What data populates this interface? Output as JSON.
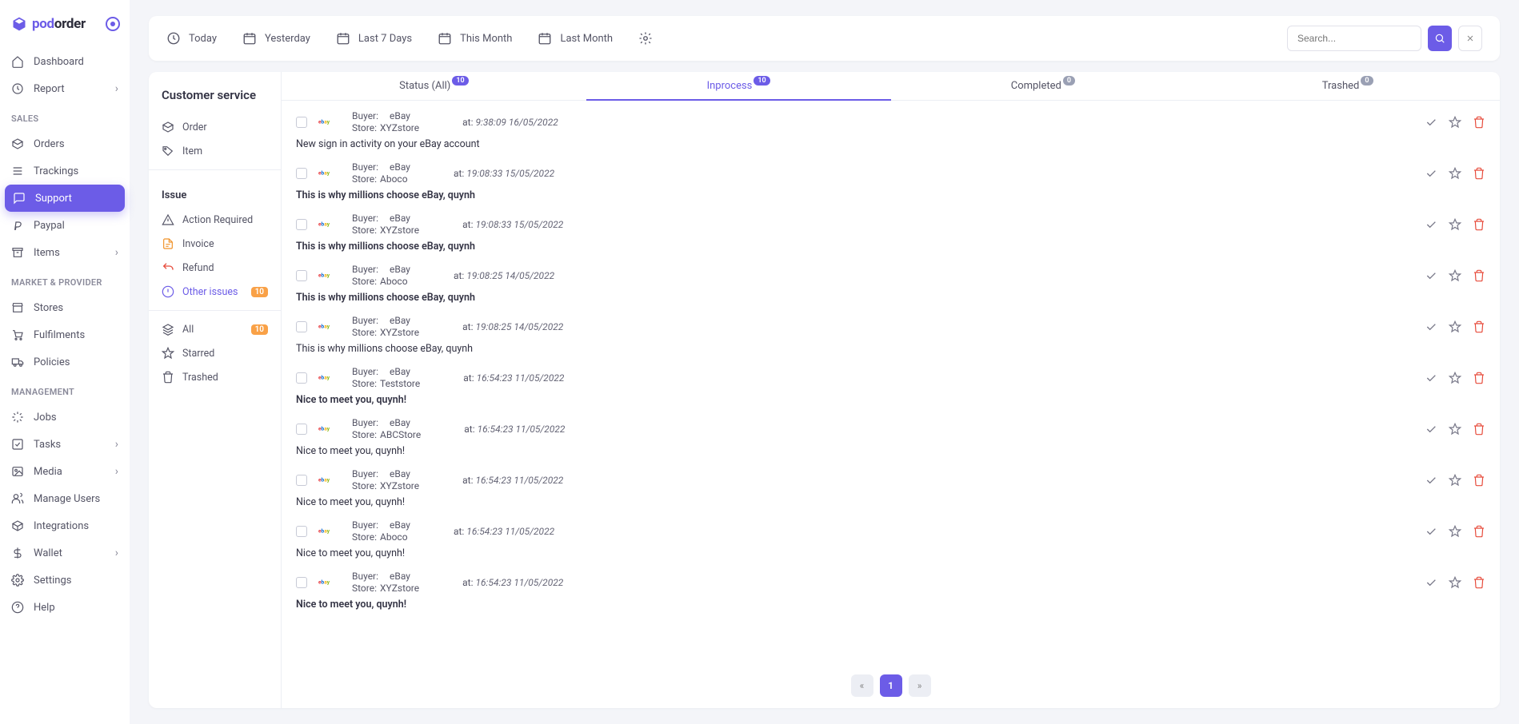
{
  "brand": {
    "name_pod": "pod",
    "name_order": "order"
  },
  "nav": {
    "dashboard": "Dashboard",
    "report": "Report",
    "sales": "SALES",
    "orders": "Orders",
    "trackings": "Trackings",
    "support": "Support",
    "paypal": "Paypal",
    "items": "Items",
    "market": "MARKET & PROVIDER",
    "stores": "Stores",
    "fulfilments": "Fulfilments",
    "policies": "Policies",
    "management": "MANAGEMENT",
    "jobs": "Jobs",
    "tasks": "Tasks",
    "media": "Media",
    "manage_users": "Manage Users",
    "integrations": "Integrations",
    "wallet": "Wallet",
    "settings": "Settings",
    "help": "Help"
  },
  "toolbar": {
    "today": "Today",
    "yesterday": "Yesterday",
    "last7": "Last 7 Days",
    "this_month": "This Month",
    "last_month": "Last Month",
    "search_placeholder": "Search..."
  },
  "cs": {
    "title": "Customer service",
    "order": "Order",
    "item": "Item",
    "issue": "Issue",
    "action_required": "Action Required",
    "invoice": "Invoice",
    "refund": "Refund",
    "other_issues": "Other issues",
    "other_issues_badge": "10",
    "all": "All",
    "all_badge": "10",
    "starred": "Starred",
    "trashed": "Trashed"
  },
  "tabs": {
    "status_all": "Status (All)",
    "status_all_count": "10",
    "inprocess": "Inprocess",
    "inprocess_count": "10",
    "completed": "Completed",
    "completed_count": "0",
    "trashed": "Trashed",
    "trashed_count": "0"
  },
  "labels": {
    "buyer": "Buyer:",
    "store": "Store:",
    "at": "at:"
  },
  "rows": [
    {
      "buyer": "eBay",
      "store": "XYZstore",
      "time": "9:38:09 16/05/2022",
      "subject": "New sign in activity on your eBay account",
      "bold": false
    },
    {
      "buyer": "eBay",
      "store": "Aboco",
      "time": "19:08:33 15/05/2022",
      "subject": "This is why millions choose eBay, quynh",
      "bold": true
    },
    {
      "buyer": "eBay",
      "store": "XYZstore",
      "time": "19:08:33 15/05/2022",
      "subject": "This is why millions choose eBay, quynh",
      "bold": true
    },
    {
      "buyer": "eBay",
      "store": "Aboco",
      "time": "19:08:25 14/05/2022",
      "subject": "This is why millions choose eBay, quynh",
      "bold": true
    },
    {
      "buyer": "eBay",
      "store": "XYZstore",
      "time": "19:08:25 14/05/2022",
      "subject": "This is why millions choose eBay, quynh",
      "bold": false
    },
    {
      "buyer": "eBay",
      "store": "Teststore",
      "time": "16:54:23 11/05/2022",
      "subject": "Nice to meet you, quynh!",
      "bold": true
    },
    {
      "buyer": "eBay",
      "store": "ABCStore",
      "time": "16:54:23 11/05/2022",
      "subject": "Nice to meet you, quynh!",
      "bold": false
    },
    {
      "buyer": "eBay",
      "store": "XYZstore",
      "time": "16:54:23 11/05/2022",
      "subject": "Nice to meet you, quynh!",
      "bold": false
    },
    {
      "buyer": "eBay",
      "store": "Aboco",
      "time": "16:54:23 11/05/2022",
      "subject": "Nice to meet you, quynh!",
      "bold": false
    },
    {
      "buyer": "eBay",
      "store": "XYZstore",
      "time": "16:54:23 11/05/2022",
      "subject": "Nice to meet you, quynh!",
      "bold": true
    }
  ],
  "pagination": {
    "page": "1"
  }
}
